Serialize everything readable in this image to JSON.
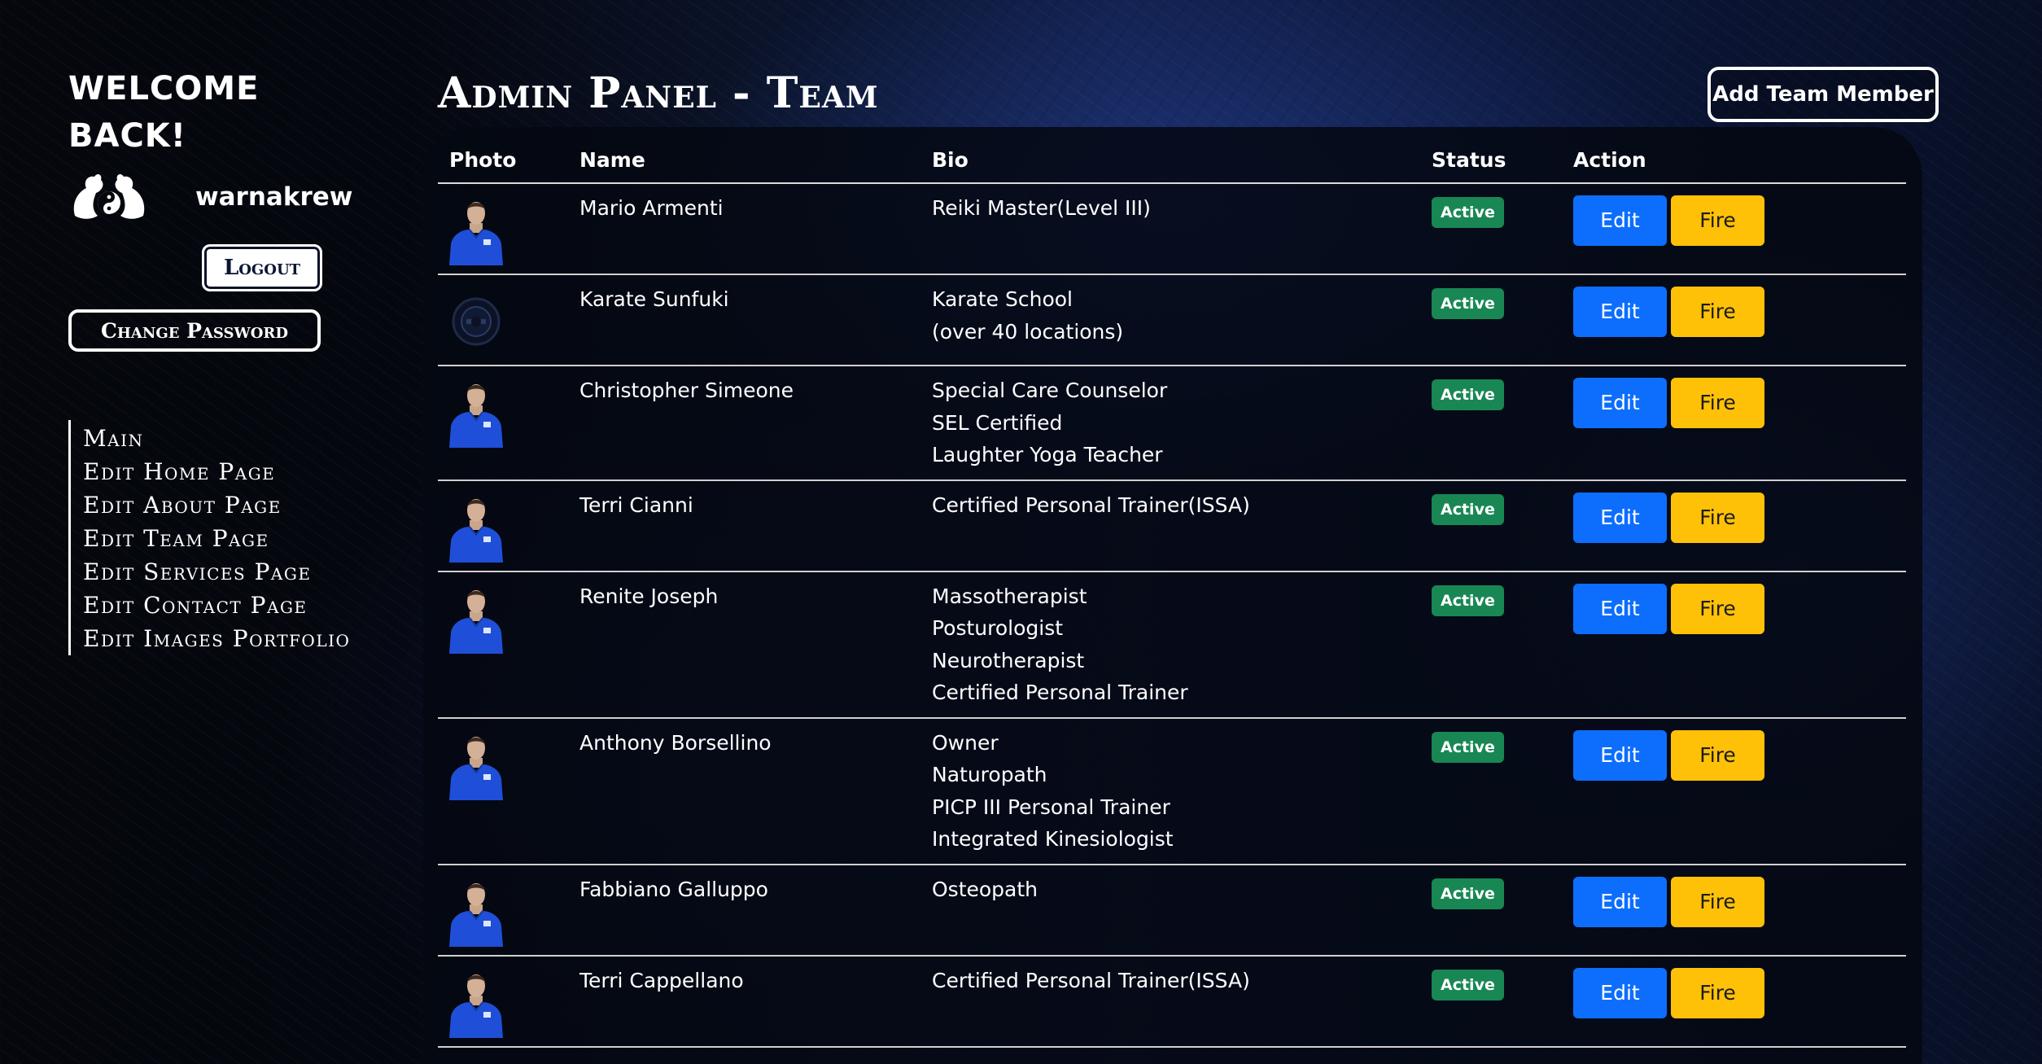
{
  "sidebar": {
    "welcome": "WELCOME BACK!",
    "username": "warnakrew",
    "logout_label": "Logout",
    "change_password_label": "Change Password",
    "nav": [
      {
        "label": "Main"
      },
      {
        "label": "Edit Home Page"
      },
      {
        "label": "Edit About Page"
      },
      {
        "label": "Edit Team Page"
      },
      {
        "label": "Edit Services Page"
      },
      {
        "label": "Edit Contact Page"
      },
      {
        "label": "Edit Images Portfolio"
      }
    ]
  },
  "main": {
    "title": "Admin Panel - Team",
    "add_member_label": "Add Team Member"
  },
  "table": {
    "headers": {
      "photo": "Photo",
      "name": "Name",
      "bio": "Bio",
      "status": "Status",
      "action": "Action"
    },
    "edit_label": "Edit",
    "fire_label": "Fire",
    "rows": [
      {
        "name": "Mario Armenti",
        "bio": [
          "Reiki Master(Level III)"
        ],
        "status": "Active",
        "photo": "team-member-photo"
      },
      {
        "name": "Karate Sunfuki",
        "bio": [
          "Karate School",
          "(over 40 locations)"
        ],
        "status": "Active",
        "photo": "karate-logo"
      },
      {
        "name": "Christopher Simeone",
        "bio": [
          "Special Care Counselor",
          "SEL Certified",
          "Laughter Yoga Teacher"
        ],
        "status": "Active",
        "photo": "team-member-photo"
      },
      {
        "name": "Terri Cianni",
        "bio": [
          "Certified Personal Trainer(ISSA)"
        ],
        "status": "Active",
        "photo": "team-member-photo"
      },
      {
        "name": "Renite Joseph",
        "bio": [
          "Massotherapist",
          "Posturologist",
          "Neurotherapist",
          "Certified Personal Trainer"
        ],
        "status": "Active",
        "photo": "team-member-photo"
      },
      {
        "name": "Anthony Borsellino",
        "bio": [
          "Owner",
          "Naturopath",
          "PICP III Personal Trainer",
          "Integrated Kinesiologist"
        ],
        "status": "Active",
        "photo": "team-member-photo"
      },
      {
        "name": "Fabbiano Galluppo",
        "bio": [
          "Osteopath"
        ],
        "status": "Active",
        "photo": "team-member-photo"
      },
      {
        "name": "Terri Cappellano",
        "bio": [
          "Certified Personal Trainer(ISSA)"
        ],
        "status": "Active",
        "photo": "team-member-photo"
      }
    ]
  },
  "colors": {
    "edit_button": "#0d6efd",
    "fire_button": "#ffc107",
    "active_badge": "#198754",
    "shirt_blue": "#1f4fd8"
  }
}
